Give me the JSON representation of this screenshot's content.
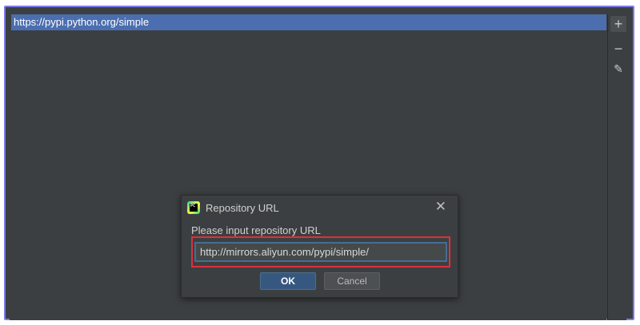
{
  "repositories": {
    "items": [
      {
        "url": "https://pypi.python.org/simple",
        "selected": true
      }
    ]
  },
  "toolbar": {
    "add_icon": "plus-icon",
    "remove_icon": "minus-icon",
    "edit_icon": "pencil-icon",
    "add_glyph": "+",
    "remove_glyph": "−",
    "edit_glyph": "✎"
  },
  "dialog": {
    "title": "Repository URL",
    "app_icon": "pycharm-icon",
    "app_icon_text": "PC",
    "close_glyph": "✕",
    "prompt": "Please input repository URL",
    "input_value": "http://mirrors.aliyun.com/pypi/simple/",
    "ok_label": "OK",
    "cancel_label": "Cancel"
  },
  "colors": {
    "background": "#3c3f41",
    "selection": "#4b6eaf",
    "highlight_border": "#e0303a",
    "frame_border": "#7b7be8",
    "ok_button": "#365880"
  }
}
